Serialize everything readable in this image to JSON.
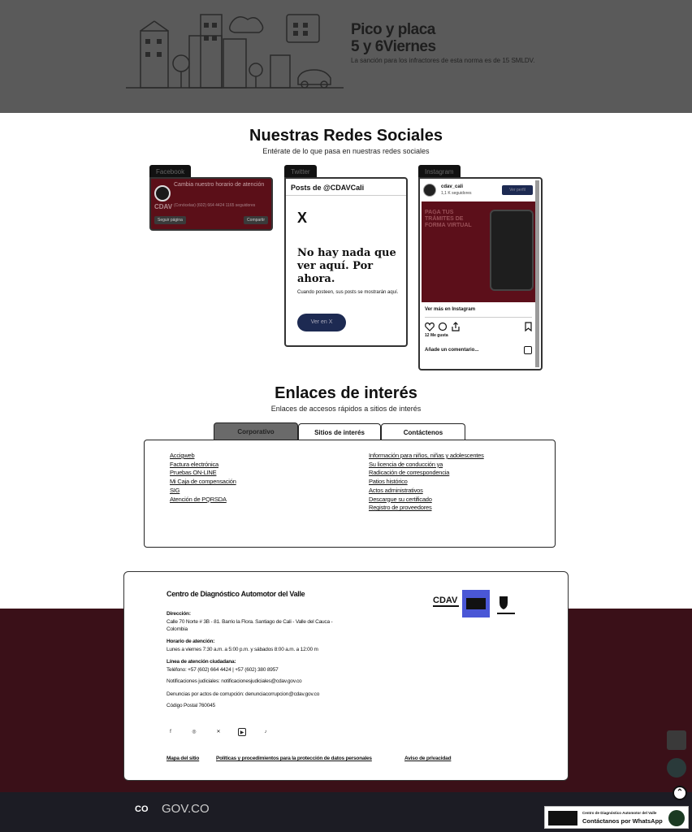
{
  "banner": {
    "title_line1": "Pico y placa",
    "title_line2": "5 y 6Viernes",
    "subtitle": "La sanción para los infractores de esta norma es de 15 SMLDV."
  },
  "social": {
    "title": "Nuestras Redes Sociales",
    "subtitle": "Entérate de lo que pasa en nuestras redes sociales",
    "facebook": {
      "tab": "Facebook",
      "text": "Cambia nuestro horario de atención",
      "brand": "CDAV",
      "small_text": "(Conócelas) (602) 664 4424 1165 seguidores",
      "follow_label": "Seguir página",
      "share_label": "Compartir"
    },
    "twitter": {
      "tab": "Twitter",
      "header": "Posts de @CDAVCali",
      "x_logo": "X",
      "empty_title": "No hay nada que ver aquí. Por ahora.",
      "empty_sub": "Cuando posteen, sus posts se mostrarán aquí.",
      "button": "Ver en X"
    },
    "instagram": {
      "tab": "Instagram",
      "user": "cdav_cali",
      "followers": "1,1 K seguidores",
      "follow_btn": "Ver perfil",
      "image_text": "PAGA TUS TRÁMITES DE FORMA VIRTUAL",
      "more": "Ver más en Instagram",
      "likes": "12 Me gusta",
      "comment": "Añade un comentario..."
    }
  },
  "links": {
    "title": "Enlaces de interés",
    "subtitle": "Enlaces de accesos rápidos a sitios de interés",
    "tabs": [
      "Corporativo",
      "Sitios de interés",
      "Contáctenos"
    ],
    "left": [
      "Accigweb",
      "Factura electrónica",
      "Pruebas ON-LINE",
      "Mi Caja de compensación",
      "SIG",
      "Atención de PQRSDA"
    ],
    "right": [
      "Información para niños, niñas y adolescentes",
      "Su licencia de conducción ya",
      "Radicación de correspondencia",
      "Patios histórico",
      "Actos administrativos",
      "Descargue su certificado",
      "Registro de proveedores"
    ]
  },
  "footer": {
    "title": "Centro de Diagnóstico Automotor del Valle",
    "address_label": "Dirección:",
    "address": "Calle 70 Norte # 3B - 81. Barrio la Flora. Santiago de Cali - Valle del Cauca - Colombia",
    "hours_label": "Horario de atención:",
    "hours": "Lunes a viernes 7:30 a.m. a 5:00 p.m. y sábados 8:00 a.m. a 12:00 m",
    "phone_label": "Línea de atención ciudadana:",
    "phone": "Teléfono: +57 (602) 664 4424 | +57 (602) 380 8957",
    "notif": "Notificaciones judiciales: notificacionesjudiciales@cdav.gov.co",
    "corruption": "Denuncias por actos de corrupción: denunciacorrupcion@cdav.gov.co",
    "postal": "Código Postal 760045",
    "logo_cdav": "CDAV",
    "links": [
      "Mapa del sitio",
      "Políticas y procedimientos para la protección de datos personales",
      "Aviso de privacidad"
    ]
  },
  "gov": {
    "badge": "CO",
    "text": "GOV.CO"
  },
  "whatsapp": {
    "line1": "Centro de Diagnóstico Automotor del Valle",
    "line2": "Contáctanos por WhatsApp"
  }
}
